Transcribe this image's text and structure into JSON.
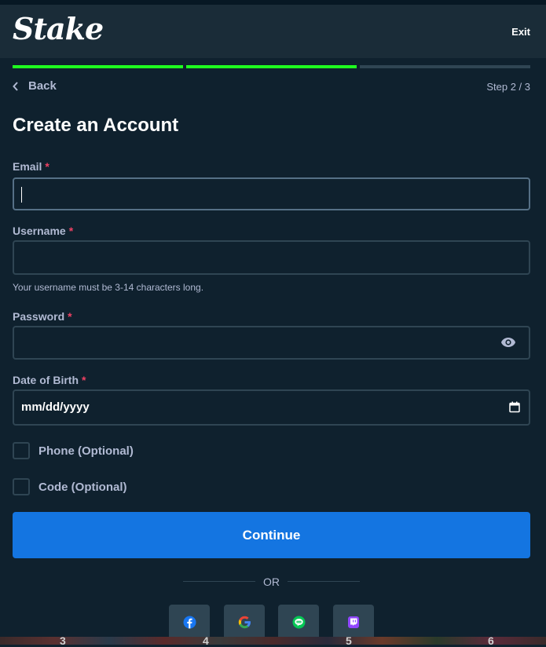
{
  "header": {
    "logo": "Stake",
    "exit_label": "Exit"
  },
  "progress": {
    "current_step": 2,
    "total_steps": 3
  },
  "nav": {
    "back_label": "Back",
    "step_label": "Step 2 / 3"
  },
  "form": {
    "title": "Create an Account",
    "required_marker": "*",
    "email": {
      "label": "Email",
      "value": ""
    },
    "username": {
      "label": "Username",
      "value": "",
      "hint": "Your username must be 3-14 characters long."
    },
    "password": {
      "label": "Password",
      "value": ""
    },
    "dob": {
      "label": "Date of Birth",
      "placeholder": "mm/dd/yyyy"
    },
    "phone_checkbox": {
      "label": "Phone (Optional)",
      "checked": false
    },
    "code_checkbox": {
      "label": "Code (Optional)",
      "checked": false
    },
    "continue_label": "Continue",
    "or_label": "OR"
  },
  "social_logins": [
    {
      "name": "facebook-icon"
    },
    {
      "name": "google-icon"
    },
    {
      "name": "line-icon"
    },
    {
      "name": "twitch-icon"
    }
  ],
  "background_strip": {
    "numbers": [
      "3",
      "4",
      "5",
      "6"
    ]
  },
  "colors": {
    "background": "#0f212e",
    "header": "#1a2c38",
    "accent_green": "#1fff20",
    "primary_button": "#1475e1",
    "required": "#ed4163",
    "muted_text": "#b1bad3",
    "border": "#2f4553"
  }
}
